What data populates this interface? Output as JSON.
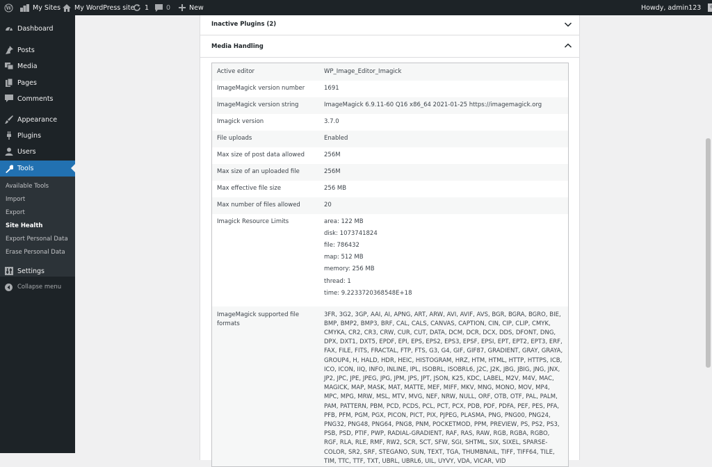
{
  "admin_bar": {
    "my_sites": "My Sites",
    "site_name": "My WordPress site",
    "updates_count": "1",
    "comments_count": "0",
    "new_label": "New",
    "howdy": "Howdy, admin123"
  },
  "sidebar": {
    "items": [
      {
        "label": "Dashboard",
        "icon": "dashboard-icon"
      },
      {
        "label": "Posts",
        "icon": "pin-icon"
      },
      {
        "label": "Media",
        "icon": "media-icon"
      },
      {
        "label": "Pages",
        "icon": "pages-icon"
      },
      {
        "label": "Comments",
        "icon": "comments-icon"
      },
      {
        "label": "Appearance",
        "icon": "brush-icon"
      },
      {
        "label": "Plugins",
        "icon": "plug-icon"
      },
      {
        "label": "Users",
        "icon": "user-icon"
      },
      {
        "label": "Tools",
        "icon": "wrench-icon"
      },
      {
        "label": "Settings",
        "icon": "settings-icon"
      },
      {
        "label": "Collapse menu",
        "icon": "collapse-icon"
      }
    ],
    "tools_submenu": [
      "Available Tools",
      "Import",
      "Export",
      "Site Health",
      "Export Personal Data",
      "Erase Personal Data"
    ]
  },
  "sections": {
    "inactive_plugins": "Inactive Plugins (2)",
    "media_handling": "Media Handling"
  },
  "media_rows": [
    {
      "label": "Active editor",
      "value": "WP_Image_Editor_Imagick"
    },
    {
      "label": "ImageMagick version number",
      "value": "1691"
    },
    {
      "label": "ImageMagick version string",
      "value": "ImageMagick 6.9.11-60 Q16 x86_64 2021-01-25 https://imagemagick.org"
    },
    {
      "label": "Imagick version",
      "value": "3.7.0"
    },
    {
      "label": "File uploads",
      "value": "Enabled"
    },
    {
      "label": "Max size of post data allowed",
      "value": "256M"
    },
    {
      "label": "Max size of an uploaded file",
      "value": "256M"
    },
    {
      "label": "Max effective file size",
      "value": "256 MB"
    },
    {
      "label": "Max number of files allowed",
      "value": "20"
    }
  ],
  "resource_limits": {
    "label": "Imagick Resource Limits",
    "lines": [
      "area: 122 MB",
      "disk: 1073741824",
      "file: 786432",
      "map: 512 MB",
      "memory: 256 MB",
      "thread: 1",
      "time: 9.2233720368548E+18"
    ]
  },
  "formats": {
    "label": "ImageMagick supported file formats",
    "value": "3FR, 3G2, 3GP, AAI, AI, APNG, ART, ARW, AVI, AVIF, AVS, BGR, BGRA, BGRO, BIE, BMP, BMP2, BMP3, BRF, CAL, CALS, CANVAS, CAPTION, CIN, CIP, CLIP, CMYK, CMYKA, CR2, CR3, CRW, CUR, CUT, DATA, DCM, DCR, DCX, DDS, DFONT, DNG, DPX, DXT1, DXT5, EPDF, EPI, EPS, EPS2, EPS3, EPSF, EPSI, EPT, EPT2, EPT3, ERF, FAX, FILE, FITS, FRACTAL, FTP, FTS, G3, G4, GIF, GIF87, GRADIENT, GRAY, GRAYA, GROUP4, H, HALD, HDR, HEIC, HISTOGRAM, HRZ, HTM, HTML, HTTP, HTTPS, ICB, ICO, ICON, IIQ, INFO, INLINE, IPL, ISOBRL, ISOBRL6, J2C, J2K, JBG, JBIG, JNG, JNX, JP2, JPC, JPE, JPEG, JPG, JPM, JPS, JPT, JSON, K25, KDC, LABEL, M2V, M4V, MAC, MAGICK, MAP, MASK, MAT, MATTE, MEF, MIFF, MKV, MNG, MONO, MOV, MP4, MPC, MPG, MRW, MSL, MTV, MVG, NEF, NRW, NULL, ORF, OTB, OTF, PAL, PALM, PAM, PATTERN, PBM, PCD, PCDS, PCL, PCT, PCX, PDB, PDF, PDFA, PEF, PES, PFA, PFB, PFM, PGM, PGX, PICON, PICT, PIX, PJPEG, PLASMA, PNG, PNG00, PNG24, PNG32, PNG48, PNG64, PNG8, PNM, POCKETMOD, PPM, PREVIEW, PS, PS2, PS3, PSB, PSD, PTIF, PWP, RADIAL-GRADIENT, RAF, RAS, RAW, RGB, RGBA, RGBO, RGF, RLA, RLE, RMF, RW2, SCR, SCT, SFW, SGI, SHTML, SIX, SIXEL, SPARSE-COLOR, SR2, SRF, STEGANO, SUN, TEXT, TGA, THUMBNAIL, TIFF, TIFF64, TILE, TIM, TTC, TTF, TXT, UBRL, UBRL6, UIL, UYVY, VDA, VICAR, VID"
  },
  "colors": {
    "admin_dark": "#1d2327",
    "accent": "#2271b1",
    "background": "#f0f0f1"
  }
}
